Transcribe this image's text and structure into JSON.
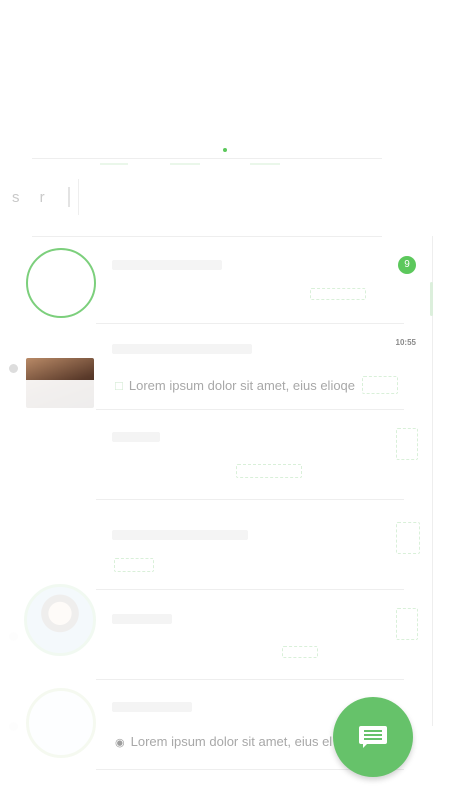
{
  "search": {
    "label": "s r"
  },
  "chats": [
    {
      "time": "",
      "badge": "9",
      "message": ""
    },
    {
      "time": "10:55",
      "badge": "",
      "message": "Lorem ipsum dolor sit amet, eius elioqe"
    },
    {
      "time": "",
      "badge": "",
      "message": ""
    },
    {
      "time": "",
      "badge": "",
      "message": ""
    },
    {
      "time": "",
      "badge": "",
      "message": ""
    },
    {
      "time": "",
      "badge": "",
      "message": "Lorem ipsum dolor sit amet, eius el"
    }
  ],
  "icons": {
    "fab": "chat-icon",
    "seen": "eye-icon",
    "delivered": "message-icon"
  },
  "colors": {
    "accent": "#66c26a",
    "badge": "#5cc85c",
    "divider": "#eeeeee",
    "text_muted": "#a8a8a8"
  }
}
